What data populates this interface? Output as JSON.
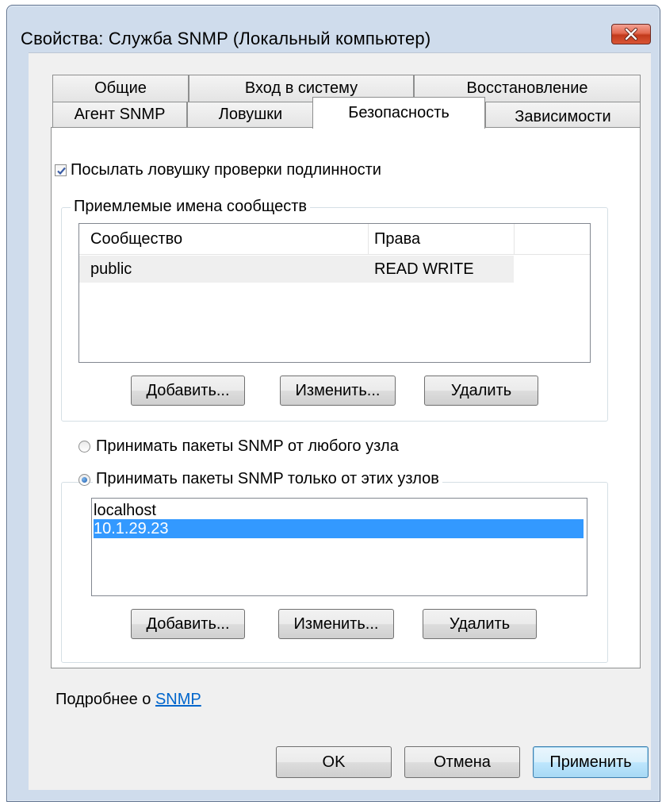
{
  "window": {
    "title": "Свойства: Служба SNMP (Локальный компьютер)"
  },
  "tabs": {
    "row1": [
      {
        "label": "Общие"
      },
      {
        "label": "Вход в систему"
      },
      {
        "label": "Восстановление"
      }
    ],
    "row2": [
      {
        "label": "Агент SNMP"
      },
      {
        "label": "Ловушки"
      },
      {
        "label": "Безопасность"
      },
      {
        "label": "Зависимости"
      }
    ],
    "active": "Безопасность"
  },
  "security": {
    "send_auth_trap_label": "Посылать ловушку проверки подлинности",
    "send_auth_trap_checked": true,
    "communities_group_label": "Приемлемые имена сообществ",
    "communities_columns": [
      "Сообщество",
      "Права"
    ],
    "communities_rows": [
      {
        "community": "public",
        "rights": "READ WRITE"
      }
    ],
    "communities_buttons": {
      "add": "Добавить...",
      "edit": "Изменить...",
      "remove": "Удалить"
    },
    "accept_any_label": "Принимать пакеты SNMP от любого узла",
    "accept_these_label": "Принимать пакеты SNMP только от этих узлов",
    "accept_mode": "these",
    "hosts": [
      {
        "name": "localhost",
        "selected": false
      },
      {
        "name": "10.1.29.23",
        "selected": true
      }
    ],
    "hosts_buttons": {
      "add": "Добавить...",
      "edit": "Изменить...",
      "remove": "Удалить"
    },
    "more_info_prefix": "Подробнее о ",
    "more_info_link": "SNMP"
  },
  "footer": {
    "ok": "OK",
    "cancel": "Отмена",
    "apply": "Применить"
  },
  "colors": {
    "frame": "#cfdcec",
    "selection": "#3399ff",
    "link": "#0066cc",
    "close_button": "#c23a1c"
  }
}
